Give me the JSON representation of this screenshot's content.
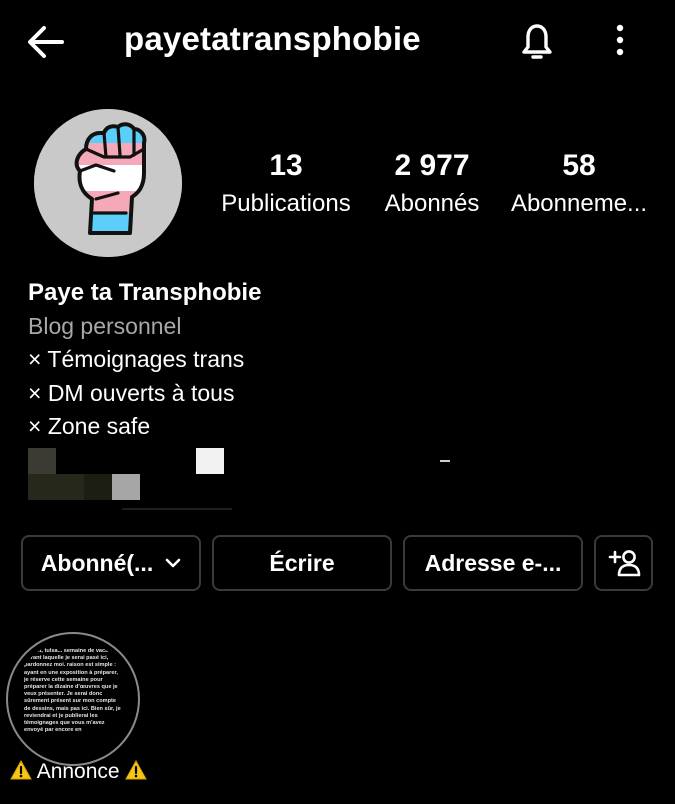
{
  "header": {
    "username": "payetatransphobie"
  },
  "profile": {
    "stats": [
      {
        "value": "13",
        "label": "Publications"
      },
      {
        "value": "2 977",
        "label": "Abonnés"
      },
      {
        "value": "58",
        "label": "Abonneme..."
      }
    ],
    "name": "Paye ta Transphobie",
    "category": "Blog personnel",
    "bio_lines": [
      "× Témoignages trans",
      "× DM ouverts à tous",
      "× Zone safe"
    ]
  },
  "actions": {
    "follow_label": "Abonné(...",
    "message_label": "Écrire",
    "email_label": "Adresse e-..."
  },
  "highlights": [
    {
      "label": "Annonce",
      "cover_text": "...avait, tulsa... semaine de vacances. durant laquelle je serai pasé ici, pardonnez moi. raison est simple : ayant en une exposition à préparer, je réserve cette semaine pour préparer la dizaine d'œuvres que je veux présenter. Je serai donc sûrement présent sur mon compte de dessins, mais pas ici. Bien sûr, je reviendrai et je publierai les témoignages que vous m'avez envoyé par encore en"
    }
  ],
  "colors": {
    "background": "#000000",
    "text": "#ffffff",
    "muted": "#a8a8a8",
    "button_border": "#3a3a3a",
    "flag_blue": "#5bcefa",
    "flag_pink": "#f5a9b8",
    "flag_white": "#ffffff"
  },
  "icons": {
    "back": "arrow-left-icon",
    "notifications": "bell-icon",
    "more": "vertical-ellipsis-icon",
    "follow_dropdown": "chevron-down-icon",
    "suggested": "add-person-icon",
    "warning": "warning-icon"
  }
}
